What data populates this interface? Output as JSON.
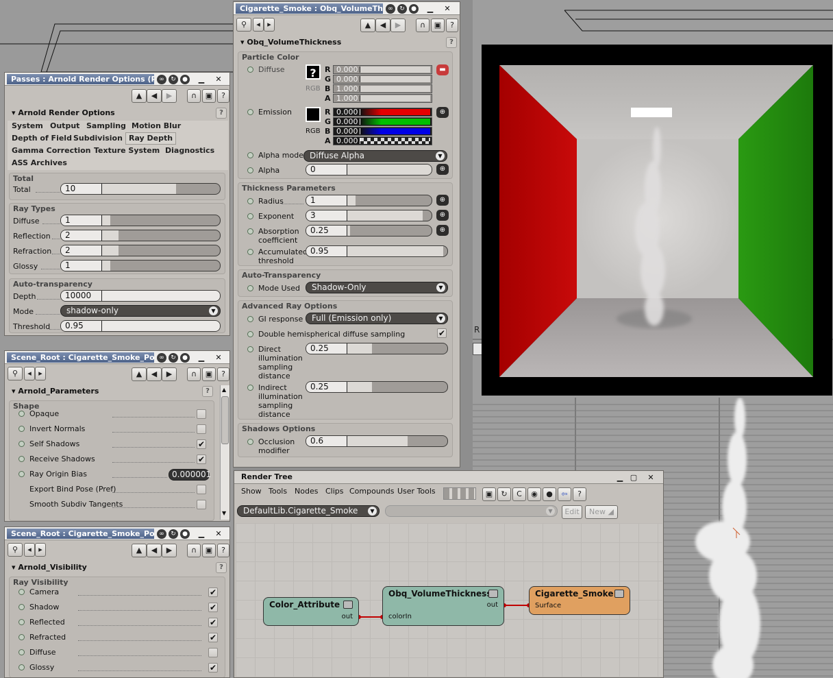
{
  "viewport_label": "R",
  "passes": {
    "title": "Passes : Arnold Render Options (Pa...",
    "section": "Arnold Render Options",
    "tabs": [
      "System",
      "Output",
      "Sampling",
      "Motion Blur",
      "Depth of Field",
      "Subdivision",
      "Ray Depth",
      "Gamma Correction",
      "Texture System",
      "Diagnostics",
      "ASS Archives"
    ],
    "active_tab": "Ray Depth",
    "total_group": "Total",
    "total_label": "Total",
    "total_value": "10",
    "ray_types_group": "Ray Types",
    "ray_types": [
      {
        "label": "Diffuse",
        "value": "1"
      },
      {
        "label": "Reflection",
        "value": "2"
      },
      {
        "label": "Refraction",
        "value": "2"
      },
      {
        "label": "Glossy",
        "value": "1"
      }
    ],
    "auto_group": "Auto-transparency",
    "depth_label": "Depth",
    "depth_value": "10000",
    "mode_label": "Mode",
    "mode_value": "shadow-only",
    "threshold_label": "Threshold",
    "threshold_value": "0.95"
  },
  "scene1": {
    "title": "Scene_Root : Cigarette_Smoke_Po...",
    "section": "Arnold_Parameters",
    "group": "Shape",
    "params": [
      {
        "label": "Opaque",
        "checked": false,
        "led": true
      },
      {
        "label": "Invert Normals",
        "checked": false,
        "led": true
      },
      {
        "label": "Self Shadows",
        "checked": true,
        "led": true
      },
      {
        "label": "Receive Shadows",
        "checked": true,
        "led": true
      },
      {
        "label": "Ray Origin Bias",
        "value": "0.000001",
        "led": true
      },
      {
        "label": "Export Bind Pose (Pref)",
        "checked": false,
        "led": false
      },
      {
        "label": "Smooth Subdiv Tangents",
        "checked": false,
        "led": false
      }
    ]
  },
  "scene2": {
    "title": "Scene_Root : Cigarette_Smoke_Po...",
    "section": "Arnold_Visibility",
    "group": "Ray Visibility",
    "params": [
      {
        "label": "Camera",
        "checked": true
      },
      {
        "label": "Shadow",
        "checked": true
      },
      {
        "label": "Reflected",
        "checked": true
      },
      {
        "label": "Refracted",
        "checked": true
      },
      {
        "label": "Diffuse",
        "checked": false
      },
      {
        "label": "Glossy",
        "checked": true
      }
    ]
  },
  "shader": {
    "title": "Cigarette_Smoke : Obq_VolumeThic...",
    "section": "Obq_VolumeThickness",
    "particle_color_group": "Particle Color",
    "diffuse_label": "Diffuse",
    "diffuse_swatch": "?",
    "rgb_label": "RGB",
    "diffuse_channels": [
      {
        "ch": "R",
        "value": "0.000"
      },
      {
        "ch": "G",
        "value": "0.000"
      },
      {
        "ch": "B",
        "value": "1.000"
      },
      {
        "ch": "A",
        "value": "1.000"
      }
    ],
    "emission_label": "Emission",
    "emission_channels": [
      {
        "ch": "R",
        "value": "0.000",
        "color": "#e60000"
      },
      {
        "ch": "G",
        "value": "0.000",
        "color": "#00c000"
      },
      {
        "ch": "B",
        "value": "0.000",
        "color": "#0000e6"
      },
      {
        "ch": "A",
        "value": "0.000",
        "color": "checker"
      }
    ],
    "alpha_mode_label": "Alpha mode",
    "alpha_mode_value": "Diffuse Alpha",
    "alpha_label": "Alpha",
    "alpha_value": "0",
    "thickness_group": "Thickness Parameters",
    "radius_label": "Radius",
    "radius_value": "1",
    "exponent_label": "Exponent",
    "exponent_value": "3",
    "absorption_label": "Absorption coefficient",
    "absorption_value": "0.25",
    "accum_label": "Accumulated threshold",
    "accum_value": "0.95",
    "auto_group": "Auto-Transparency",
    "mode_used_label": "Mode Used",
    "mode_used_value": "Shadow-Only",
    "adv_group": "Advanced Ray Options",
    "gi_label": "GI response",
    "gi_value": "Full (Emission only)",
    "double_label": "Double hemispherical diffuse sampling",
    "double_checked": true,
    "direct_label": "Direct illumination sampling distance",
    "direct_value": "0.25",
    "indirect_label": "Indirect illumination sampling distance",
    "indirect_value": "0.25",
    "shadows_group": "Shadows Options",
    "occlusion_label": "Occlusion modifier",
    "occlusion_value": "0.6"
  },
  "render_tree": {
    "title": "Render Tree",
    "menus": [
      "Show",
      "Tools",
      "Nodes",
      "Clips",
      "Compounds",
      "User Tools"
    ],
    "library": "DefaultLib.Cigarette_Smoke",
    "edit": "Edit",
    "new": "New",
    "nodes": {
      "color_attr": {
        "title": "Color_Attribute",
        "out": "out"
      },
      "volume": {
        "title": "Obq_VolumeThickness",
        "in": "colorIn",
        "out": "out"
      },
      "smoke": {
        "title": "Cigarette_Smoke",
        "in": "Surface"
      }
    }
  },
  "colors": {
    "title_bar": "#5a6d92",
    "node_green": "#8fb8a8",
    "node_orange": "#e0a060",
    "wall_red": "#b00000",
    "wall_green": "#2c8a14"
  }
}
